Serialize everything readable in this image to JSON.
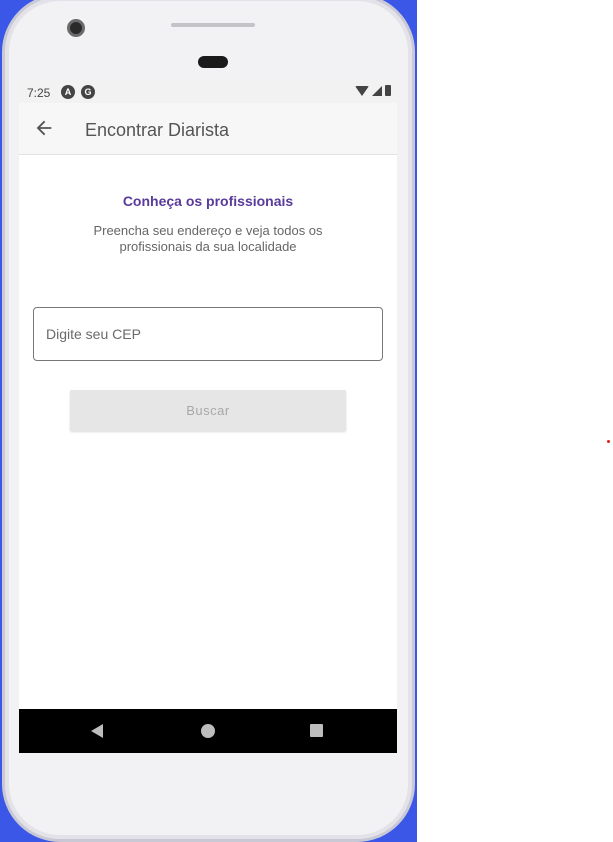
{
  "status_bar": {
    "time": "7:25",
    "icon_a": "A",
    "icon_b": "G"
  },
  "app_bar": {
    "title": "Encontrar Diarista"
  },
  "content": {
    "heading": "Conheça os profissionais",
    "subtitle": "Preencha seu endereço e veja todos os profissionais da sua localidade"
  },
  "cep_input": {
    "placeholder": "Digite seu CEP",
    "value": ""
  },
  "search_button": {
    "label": "Buscar"
  },
  "colors": {
    "accent": "#5a3a9a",
    "background": "#3b57e8"
  }
}
